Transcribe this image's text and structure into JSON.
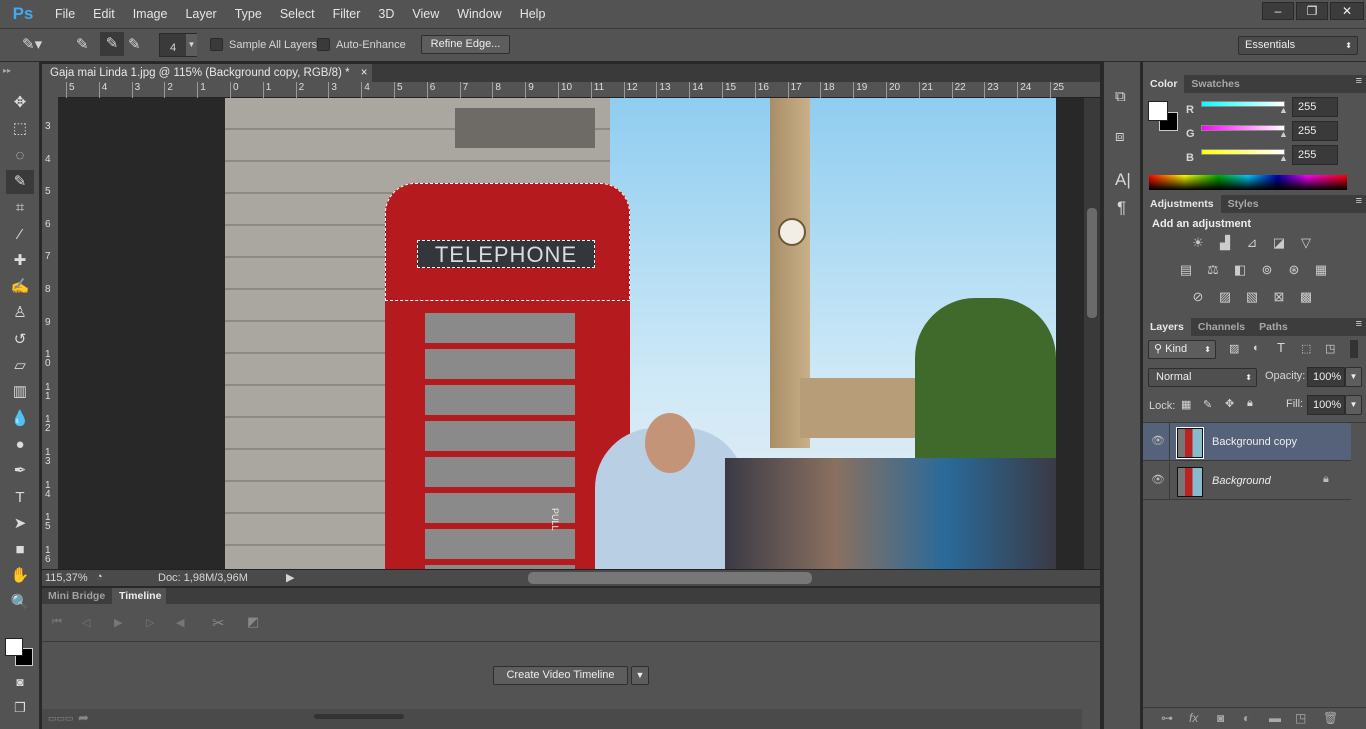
{
  "app": {
    "logo": "Ps",
    "menus": [
      "File",
      "Edit",
      "Image",
      "Layer",
      "Type",
      "Select",
      "Filter",
      "3D",
      "View",
      "Window",
      "Help"
    ],
    "window_buttons": [
      "minimize",
      "restore",
      "close"
    ]
  },
  "options": {
    "brush_size": "4",
    "sample_all_layers": "Sample All Layers",
    "sample_all_checked": false,
    "auto_enhance": "Auto-Enhance",
    "auto_enhance_checked": false,
    "refine_edge": "Refine Edge...",
    "workspace": "Essentials"
  },
  "tools": [
    {
      "name": "move-tool",
      "glyph": "✥"
    },
    {
      "name": "marquee-tool",
      "glyph": "⬚"
    },
    {
      "name": "lasso-tool",
      "glyph": "◌"
    },
    {
      "name": "quick-selection-tool",
      "glyph": "✎"
    },
    {
      "name": "crop-tool",
      "glyph": "⌗"
    },
    {
      "name": "eyedropper-tool",
      "glyph": "⁄"
    },
    {
      "name": "healing-brush-tool",
      "glyph": "✚"
    },
    {
      "name": "brush-tool",
      "glyph": "✍"
    },
    {
      "name": "clone-stamp-tool",
      "glyph": "♙"
    },
    {
      "name": "history-brush-tool",
      "glyph": "↺"
    },
    {
      "name": "eraser-tool",
      "glyph": "▱"
    },
    {
      "name": "gradient-tool",
      "glyph": "▥"
    },
    {
      "name": "blur-tool",
      "glyph": "💧"
    },
    {
      "name": "dodge-tool",
      "glyph": "●"
    },
    {
      "name": "pen-tool",
      "glyph": "✒"
    },
    {
      "name": "type-tool",
      "glyph": "T"
    },
    {
      "name": "path-selection-tool",
      "glyph": "➤"
    },
    {
      "name": "rectangle-tool",
      "glyph": "■"
    },
    {
      "name": "hand-tool",
      "glyph": "✋"
    },
    {
      "name": "zoom-tool",
      "glyph": "🔍"
    }
  ],
  "document": {
    "tab_title": "Gaja mai Linda 1.jpg @ 115% (Background copy, RGB/8) *",
    "close": "×"
  },
  "rulers": {
    "horizontal": [
      "5",
      "4",
      "3",
      "2",
      "1",
      "0",
      "1",
      "2",
      "3",
      "4",
      "5",
      "6",
      "7",
      "8",
      "9",
      "10",
      "11",
      "12",
      "13",
      "14",
      "15",
      "16",
      "17",
      "18",
      "19",
      "20",
      "21",
      "22",
      "23",
      "24",
      "25"
    ],
    "vertical": [
      "3",
      "4",
      "5",
      "6",
      "7",
      "8",
      "9",
      "10",
      "11",
      "12",
      "13",
      "14",
      "15",
      "16"
    ]
  },
  "photo": {
    "sign": "TELEPHONE",
    "pull": "PULL"
  },
  "status": {
    "zoom": "115,37%",
    "doc": "Doc: 1,98M/3,96M"
  },
  "bottom": {
    "tabs": [
      "Mini Bridge",
      "Timeline"
    ],
    "active_tab": "Timeline",
    "create_button": "Create Video Timeline"
  },
  "color_panel": {
    "tabs": [
      "Color",
      "Swatches"
    ],
    "channels": [
      {
        "label": "R",
        "value": "255",
        "color": "#00ffff"
      },
      {
        "label": "G",
        "value": "255",
        "color": "#ff00ff"
      },
      {
        "label": "B",
        "value": "255",
        "color": "#ffff00"
      }
    ],
    "foreground": "#ffffff",
    "background": "#000000"
  },
  "adjustments_panel": {
    "tabs": [
      "Adjustments",
      "Styles"
    ],
    "heading": "Add an adjustment",
    "rows": [
      [
        "☀",
        "▟",
        "⊿",
        "◪",
        "▽"
      ],
      [
        "▤",
        "⚖",
        "◧",
        "⊚",
        "⊛",
        "▦"
      ],
      [
        "⊘",
        "▨",
        "▧",
        "⊠",
        "▩"
      ]
    ]
  },
  "layers_panel": {
    "tabs": [
      "Layers",
      "Channels",
      "Paths"
    ],
    "filter": "Kind",
    "blend_mode": "Normal",
    "opacity_label": "Opacity:",
    "opacity": "100%",
    "lock_label": "Lock:",
    "fill_label": "Fill:",
    "fill": "100%",
    "layers": [
      {
        "name": "Background copy",
        "selected": true,
        "locked": false
      },
      {
        "name": "Background",
        "selected": false,
        "locked": true
      }
    ]
  }
}
